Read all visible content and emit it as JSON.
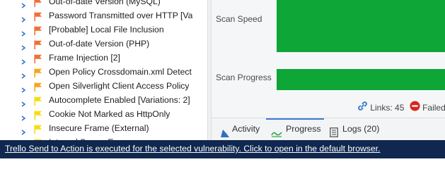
{
  "vulnerabilities": [
    {
      "label": "Out-of-date Version (MySQL)",
      "severity": "high",
      "flag_color": "#f26f36"
    },
    {
      "label": "Password Transmitted over HTTP [Va",
      "severity": "high",
      "flag_color": "#f26f36"
    },
    {
      "label": "[Probable] Local File Inclusion",
      "severity": "high",
      "flag_color": "#f26f36"
    },
    {
      "label": "Out-of-date Version (PHP)",
      "severity": "high",
      "flag_color": "#f26f36"
    },
    {
      "label": "Frame Injection [2]",
      "severity": "high",
      "flag_color": "#f26f36"
    },
    {
      "label": "Open Policy Crossdomain.xml Detect",
      "severity": "medium",
      "flag_color": "#f7a51c"
    },
    {
      "label": "Open Silverlight Client Access Policy",
      "severity": "medium",
      "flag_color": "#f7a51c"
    },
    {
      "label": "Autocomplete Enabled [Variations: 2]",
      "severity": "low",
      "flag_color": "#f4de12"
    },
    {
      "label": "Cookie Not Marked as HttpOnly",
      "severity": "low",
      "flag_color": "#f4de12"
    },
    {
      "label": "Insecure Frame (External)",
      "severity": "low",
      "flag_color": "#f4de12"
    },
    {
      "label": "Internal Server Error",
      "severity": "low",
      "flag_color": "#f4de12"
    }
  ],
  "metrics": {
    "scan_speed_label": "Scan Speed",
    "scan_progress_label": "Scan Progress",
    "bar_color": "#0fa638"
  },
  "stats": {
    "links_label": "Links: 45",
    "failed_label": "Failed R"
  },
  "tabs": [
    {
      "label": "Activity",
      "icon": "activity-icon"
    },
    {
      "label": "Progress",
      "icon": "progress-icon",
      "active": true
    },
    {
      "label": "Logs (20)",
      "icon": "logs-icon"
    }
  ],
  "status_bar": {
    "message": "Trello Send to Action is executed for the selected vulnerability. Click to open in the default browser."
  }
}
